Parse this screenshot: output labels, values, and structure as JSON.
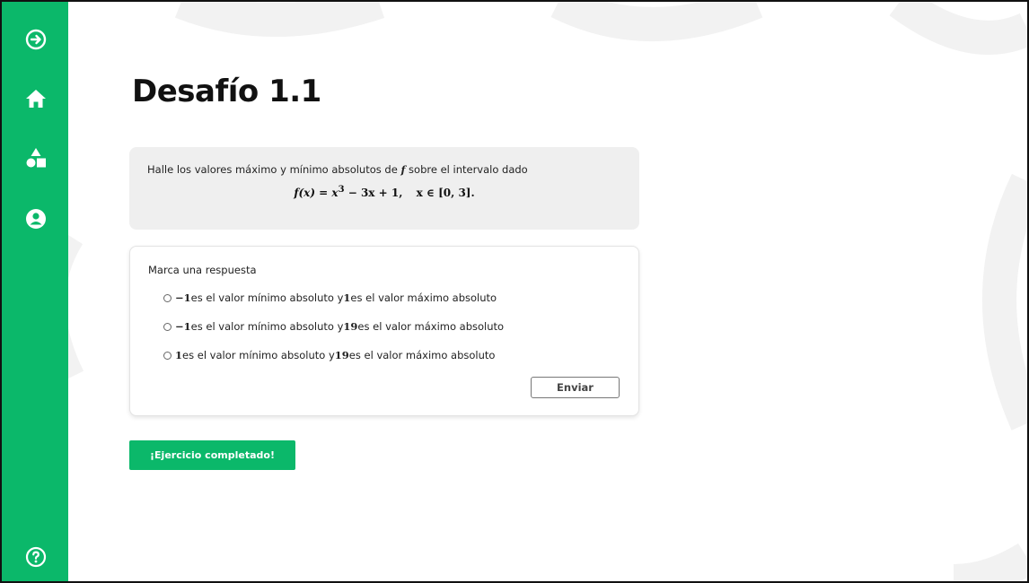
{
  "sidebar": {
    "icons": [
      "arrow-circle-right-icon",
      "home-icon",
      "shapes-icon",
      "user-circle-icon",
      "help-circle-icon"
    ],
    "color": "#0bb86a"
  },
  "page": {
    "title": "Desafío 1.1"
  },
  "problem": {
    "text_before": "Halle los valores máximo y mínimo absolutos de ",
    "variable": "f",
    "text_after": " sobre el intervalo dado",
    "formula_fx": "f(x) = x",
    "formula_exp": "3",
    "formula_rest": " − 3x + 1,",
    "formula_domain": "x ∈ [0, 3]."
  },
  "answer": {
    "prompt": "Marca una respuesta",
    "options": [
      {
        "min": "−1",
        "mid": " es el valor mínimo absoluto y ",
        "max": "1",
        "end": " es el valor máximo absoluto"
      },
      {
        "min": "−1",
        "mid": " es el valor mínimo absoluto y ",
        "max": "19",
        "end": " es el valor máximo absoluto"
      },
      {
        "min": "1",
        "mid": " es el valor mínimo absoluto y ",
        "max": "19",
        "end": " es el valor máximo absoluto"
      }
    ],
    "submit_label": "Enviar"
  },
  "footer": {
    "complete_label": "¡Ejercicio completado!"
  }
}
